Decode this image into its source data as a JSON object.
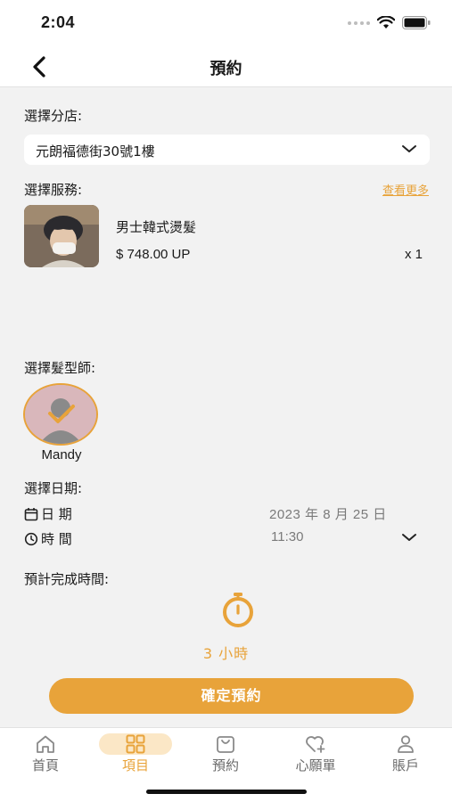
{
  "status_bar": {
    "time": "2:04"
  },
  "nav": {
    "title": "預約"
  },
  "branch": {
    "label": "選擇分店:",
    "value": "元朗福德街30號1樓"
  },
  "service": {
    "label": "選擇服務:",
    "see_more": "查看更多",
    "name": "男士韓式燙髮",
    "price": "$ 748.00 UP",
    "qty": "x 1"
  },
  "stylist": {
    "label": "選擇髮型師:",
    "name": "Mandy"
  },
  "datetime": {
    "label": "選擇日期:",
    "date_label": "日 期",
    "date_value": "2023 年 8 月 25 日",
    "time_label": "時 間",
    "time_value": "11:30"
  },
  "estimate": {
    "label": "預計完成時間:",
    "duration": "3 小時"
  },
  "confirm_label": "確定預約",
  "tabs": [
    {
      "label": "首頁",
      "icon": "home-icon"
    },
    {
      "label": "項目",
      "icon": "grid-icon"
    },
    {
      "label": "預約",
      "icon": "bag-icon"
    },
    {
      "label": "心願單",
      "icon": "heart-icon"
    },
    {
      "label": "賬戶",
      "icon": "user-icon"
    }
  ],
  "active_tab": "項目",
  "colors": {
    "accent": "#e8a33a",
    "background": "#f2f2f2"
  }
}
